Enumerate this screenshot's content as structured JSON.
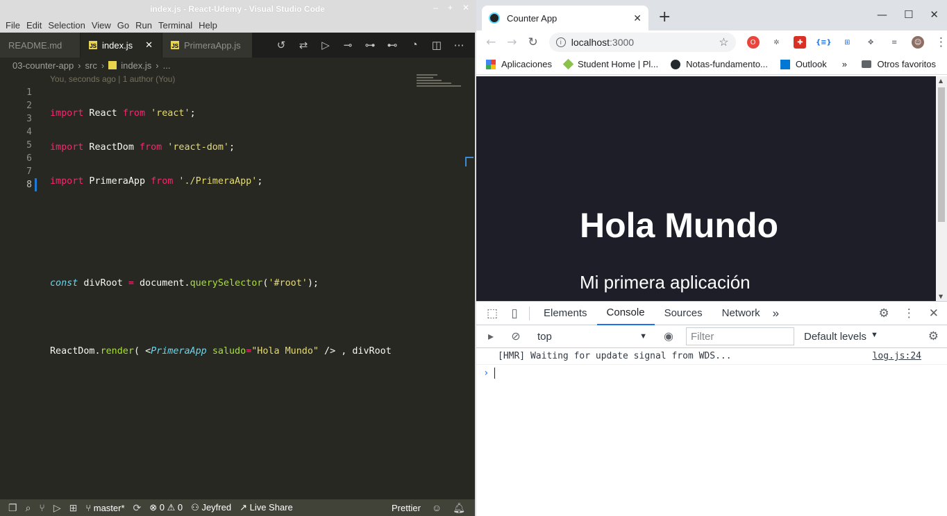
{
  "vscode": {
    "window_title": "index.js - React-Udemy - Visual Studio Code",
    "menu": [
      "File",
      "Edit",
      "Selection",
      "View",
      "Go",
      "Run",
      "Terminal",
      "Help"
    ],
    "tabs": [
      {
        "label": "README.md",
        "active": false
      },
      {
        "label": "index.js",
        "active": true
      },
      {
        "label": "PrimeraApp.js",
        "active": false
      }
    ],
    "breadcrumb": [
      "03-counter-app",
      "src",
      "index.js",
      "..."
    ],
    "blame": "You, seconds ago | 1 author (You)",
    "line_numbers": [
      "1",
      "2",
      "3",
      "4",
      "5",
      "6",
      "7",
      "8"
    ],
    "code": {
      "l1": {
        "kw1": "import",
        "id": " React ",
        "kw2": "from",
        "str": " 'react'",
        "end": ";"
      },
      "l2": {
        "kw1": "import",
        "id": " ReactDom ",
        "kw2": "from",
        "str": " 'react-dom'",
        "end": ";"
      },
      "l3": {
        "kw1": "import",
        "id": " PrimeraApp ",
        "kw2": "from",
        "str": " './PrimeraApp'",
        "end": ";"
      },
      "l6": {
        "kw": "const",
        "id": " divRoot ",
        "op": "=",
        "obj": " document.",
        "fn": "querySelector",
        "open": "(",
        "str": "'#root'",
        "close": ");"
      },
      "l8": {
        "obj": "ReactDom.",
        "fn": "render",
        "open": "( ",
        "lt": "<",
        "tag": "PrimeraApp",
        "sp": " ",
        "attr": "saludo",
        "eq": "=",
        "str": "\"Hola Mundo\"",
        "selfclose": " />",
        "rest": " , divRoot "
      }
    },
    "status": {
      "branch": "master*",
      "errors": "0",
      "warnings": "0",
      "user": "Jeyfred",
      "live_share": "Live Share",
      "formatter": "Prettier"
    }
  },
  "chrome": {
    "tab_title": "Counter App",
    "url_host": "localhost",
    "url_port": ":3000",
    "bookmarks": [
      {
        "label": "Aplicaciones",
        "color": "#e8453c"
      },
      {
        "label": "Student Home | Pl...",
        "color": "#8bc34a"
      },
      {
        "label": "Notas-fundamento...",
        "color": "#24292e"
      },
      {
        "label": "Outlook",
        "color": "#0078d4"
      }
    ],
    "bookmarks_more": "»",
    "other_bookmarks": "Otros favoritos",
    "page": {
      "heading": "Hola Mundo",
      "paragraph": "Mi primera aplicación"
    },
    "devtools": {
      "tabs": [
        "Elements",
        "Console",
        "Sources",
        "Network"
      ],
      "active_tab": "Console",
      "more": "»",
      "context": "top",
      "filter_placeholder": "Filter",
      "levels": "Default levels",
      "log_message": "[HMR] Waiting for update signal from WDS...",
      "log_source": "log.js:24"
    }
  }
}
